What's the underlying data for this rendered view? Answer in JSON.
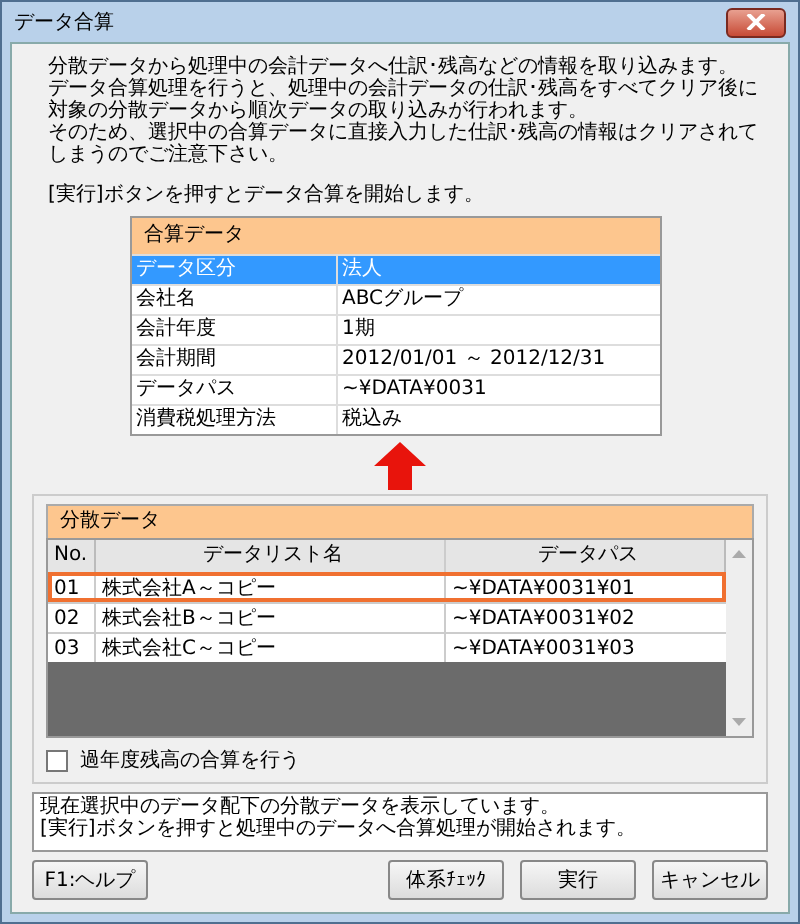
{
  "window": {
    "title": "データ合算"
  },
  "intro": [
    "分散データから処理中の会計データへ仕訳･残高などの情報を取り込みます。",
    "データ合算処理を行うと、処理中の会計データの仕訳･残高をすべてクリア後に",
    "対象の分散データから順次データの取り込みが行われます。",
    "そのため、選択中の合算データに直接入力した仕訳･残高の情報はクリアされて",
    "しまうのでご注意下さい。"
  ],
  "instruction": "[実行]ボタンを押すとデータ合算を開始します。",
  "merged": {
    "title": "合算データ",
    "rows": [
      {
        "label": "データ区分",
        "value": "法人",
        "selected": true
      },
      {
        "label": "会社名",
        "value": "ABCグループ",
        "selected": false
      },
      {
        "label": "会計年度",
        "value": "1期",
        "selected": false
      },
      {
        "label": "会計期間",
        "value": "2012/01/01 ～ 2012/12/31",
        "selected": false
      },
      {
        "label": "データパス",
        "value": "~¥DATA¥0031",
        "selected": false
      },
      {
        "label": "消費税処理方法",
        "value": "税込み",
        "selected": false
      }
    ]
  },
  "distributed": {
    "title": "分散データ",
    "columns": [
      "No.",
      "データリスト名",
      "データパス"
    ],
    "rows": [
      {
        "no": "01",
        "name": "株式会社A～コピー",
        "path": "~¥DATA¥0031¥01",
        "selected": true
      },
      {
        "no": "02",
        "name": "株式会社B～コピー",
        "path": "~¥DATA¥0031¥02",
        "selected": false
      },
      {
        "no": "03",
        "name": "株式会社C～コピー",
        "path": "~¥DATA¥0031¥03",
        "selected": false
      }
    ]
  },
  "checkbox": {
    "label": "過年度残高の合算を行う",
    "checked": false
  },
  "message": [
    "現在選択中のデータ配下の分散データを表示しています。",
    "[実行]ボタンを押すと処理中のデータへ合算処理が開始されます。"
  ],
  "buttons": {
    "help": "F1:ヘルプ",
    "actions": [
      "体系ﾁｪｯｸ",
      "実行",
      "キャンセル"
    ]
  }
}
